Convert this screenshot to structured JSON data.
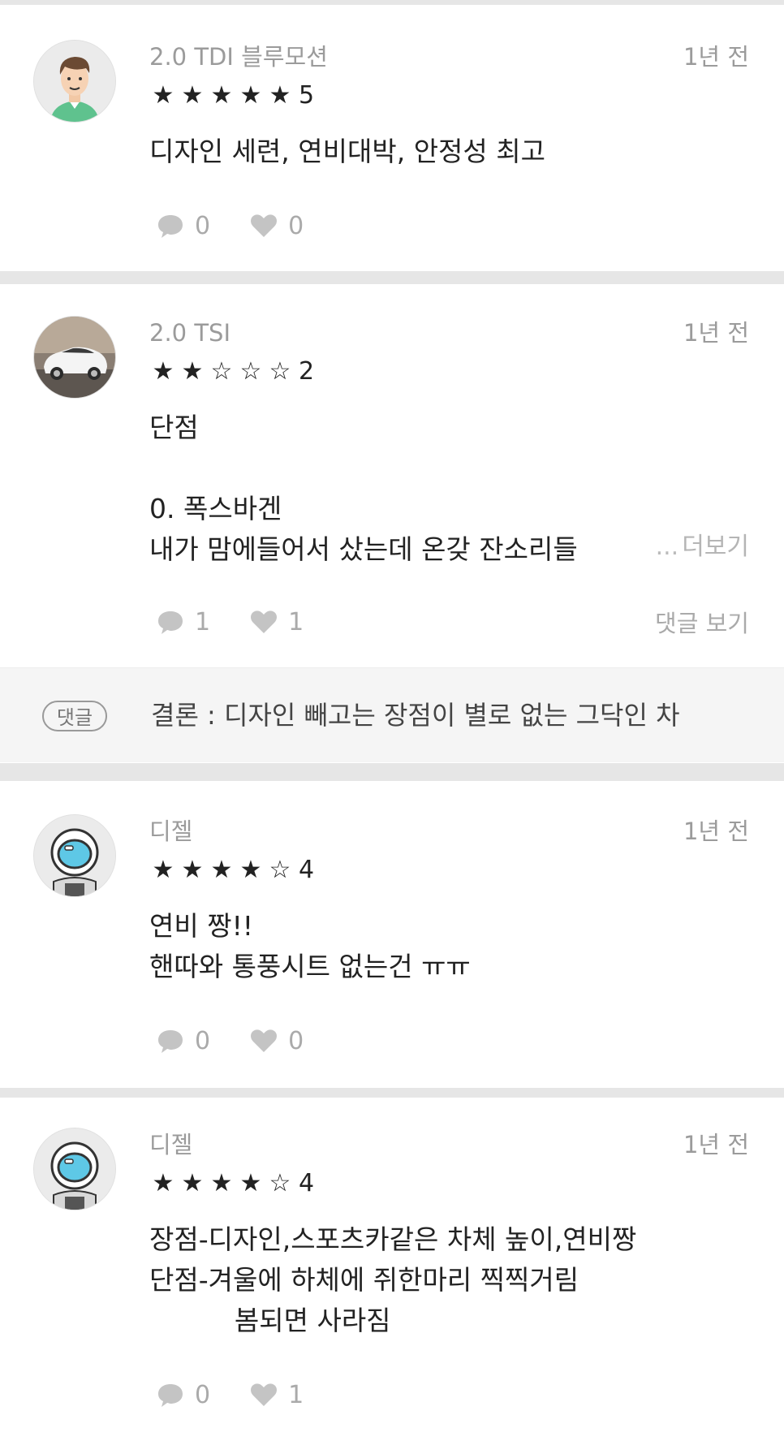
{
  "reviews": [
    {
      "trim": "2.0 TDI 블루모션",
      "time": "1년 전",
      "stars": [
        "★",
        "★",
        "★",
        "★",
        "★"
      ],
      "score": "5",
      "text": "디자인 세련, 연비대박, 안정성 최고",
      "comment_count": "0",
      "like_count": "0",
      "avatar": "man-avatar"
    },
    {
      "trim": "2.0 TSI",
      "time": "1년 전",
      "stars": [
        "★",
        "★",
        "☆",
        "☆",
        "☆"
      ],
      "score": "2",
      "text": "단점\n\n0. 폭스바겐\n내가 맘에들어서 샀는데 온갖 잔소리들",
      "more_dots": "...",
      "more_label": "더보기",
      "comment_count": "1",
      "like_count": "1",
      "view_comments_label": "댓글 보기",
      "avatar": "car-photo-avatar",
      "reply": {
        "tag": "댓글",
        "text": "결론 : 디자인 빼고는 장점이 별로 없는 그닥인 차"
      }
    },
    {
      "trim": "디젤",
      "time": "1년 전",
      "stars": [
        "★",
        "★",
        "★",
        "★",
        "☆"
      ],
      "score": "4",
      "text": "연비 짱!!\n핸따와 통풍시트 없는건 ㅠㅠ",
      "comment_count": "0",
      "like_count": "0",
      "avatar": "astronaut-avatar"
    },
    {
      "trim": "디젤",
      "time": "1년 전",
      "stars": [
        "★",
        "★",
        "★",
        "★",
        "☆"
      ],
      "score": "4",
      "text": "장점-디자인,스포츠카같은 차체 높이,연비짱\n단점-겨울에 하체에 쥐한마리 찍찍거림\n          봄되면 사라짐",
      "comment_count": "0",
      "like_count": "1",
      "avatar": "astronaut-avatar"
    }
  ],
  "colors": {
    "separator": "#e6e6e6",
    "muted_text": "#9b9b9b",
    "icon_gray": "#aaaaaa",
    "comment_bg": "#f5f5f5"
  }
}
